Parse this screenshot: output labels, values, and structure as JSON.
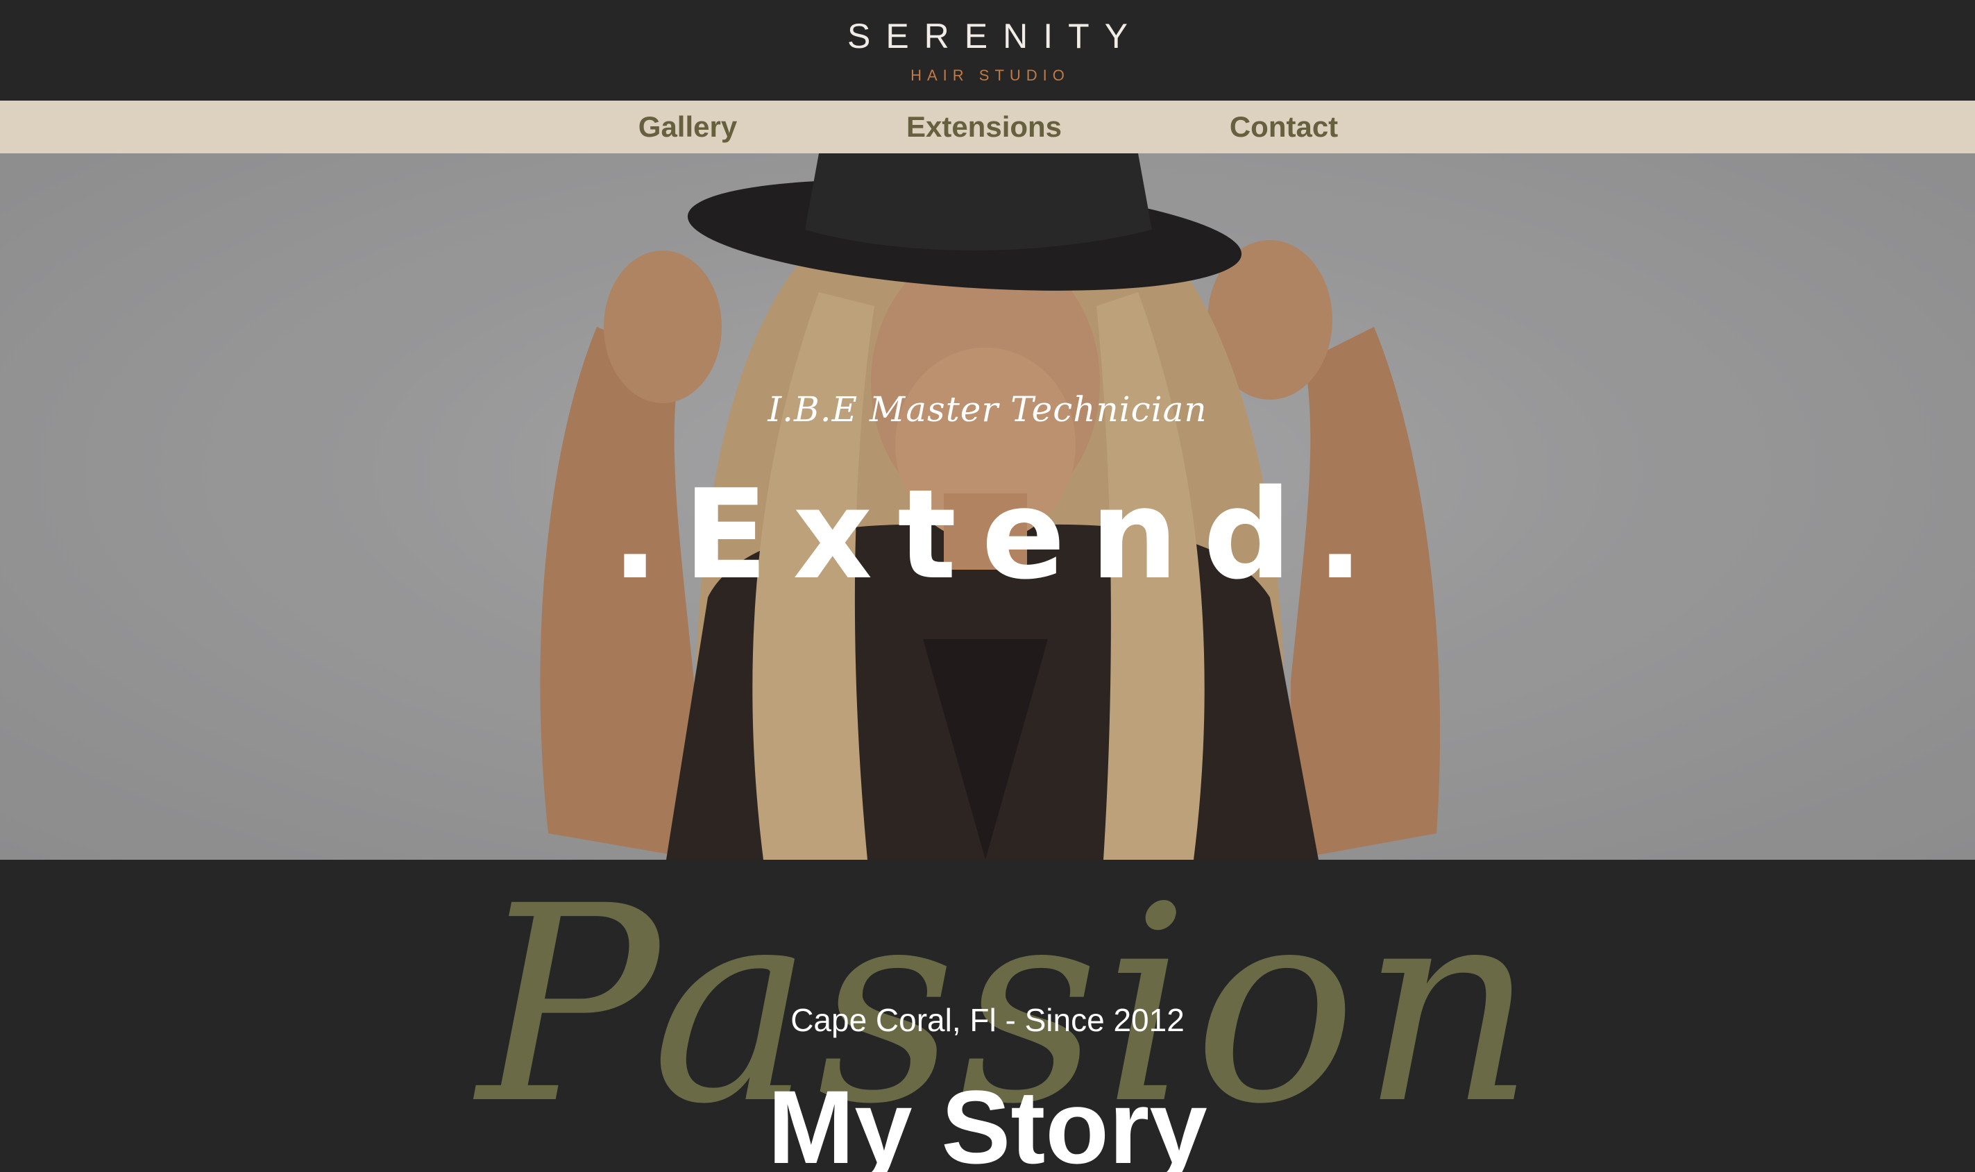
{
  "header": {
    "brand": "SERENITY",
    "brand_sub": "HAIR STUDIO"
  },
  "nav": {
    "items": [
      {
        "label": "Gallery"
      },
      {
        "label": "Extensions"
      },
      {
        "label": "Contact"
      }
    ]
  },
  "hero": {
    "subtitle": "I.B.E Master Technician",
    "title": ".Extend."
  },
  "story": {
    "backdrop_word": "Passion",
    "location": "Cape Coral, Fl - Since 2012",
    "title": "My Story"
  },
  "colors": {
    "dark_background": "#262626",
    "nav_background": "#ddd2c0",
    "nav_text": "#66603f",
    "logo_accent": "#c07a45",
    "passion_olive": "#6b6a47"
  }
}
